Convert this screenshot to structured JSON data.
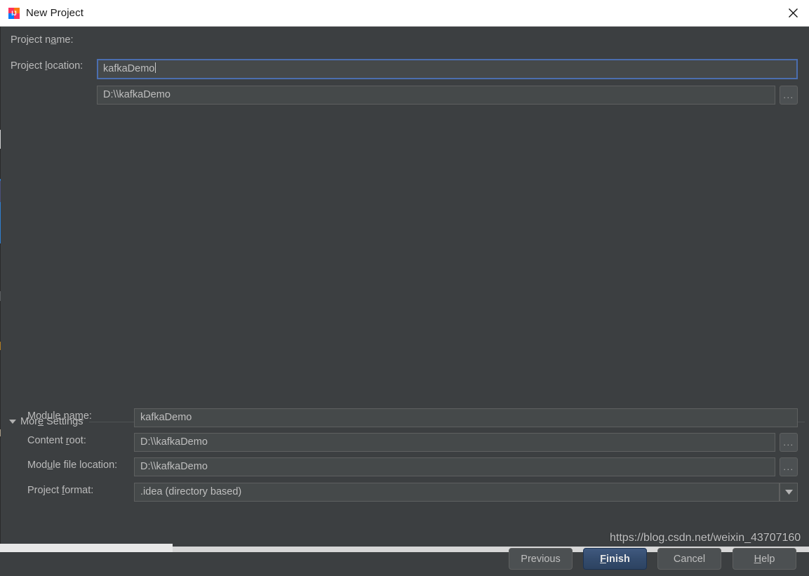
{
  "window": {
    "title": "New Project",
    "app_icon": "intellij-idea-icon",
    "close_icon": "close-icon"
  },
  "form": {
    "project_name": {
      "label": "Project name:",
      "label_mnemonic": "a",
      "value": "kafkaDemo",
      "focused": true
    },
    "project_location": {
      "label": "Project location:",
      "label_mnemonic": "l",
      "value": "D:\\\\kafkaDemo",
      "browse_label": "...",
      "browse_icon": "ellipsis-icon"
    }
  },
  "more_settings": {
    "label": "More Settings",
    "label_mnemonic": "e",
    "expanded": true,
    "toggle_icon": "triangle-down-icon",
    "fields": [
      {
        "name": "module-name",
        "label": "Module name:",
        "label_mnemonic": "m",
        "value": "kafkaDemo",
        "has_browse": false,
        "has_dropdown": false
      },
      {
        "name": "content-root",
        "label": "Content root:",
        "label_mnemonic": "r",
        "value": "D:\\\\kafkaDemo",
        "has_browse": true,
        "browse_label": "...",
        "has_dropdown": false
      },
      {
        "name": "module-file-location",
        "label": "Module file location:",
        "label_mnemonic": "u",
        "value": "D:\\\\kafkaDemo",
        "has_browse": true,
        "browse_label": "...",
        "has_dropdown": false
      },
      {
        "name": "project-format",
        "label": "Project format:",
        "label_mnemonic": "f",
        "value": ".idea (directory based)",
        "has_browse": false,
        "has_dropdown": true,
        "dropdown_icon": "chevron-down-icon"
      }
    ]
  },
  "footer": {
    "previous": "Previous",
    "finish": "Finish",
    "finish_mnemonic": "F",
    "cancel": "Cancel",
    "help": "Help",
    "help_mnemonic": "H",
    "default_button": "Finish"
  },
  "watermark": {
    "text": "https://blog.csdn.net/weixin_43707160"
  },
  "colors": {
    "dialog_bg": "#3c3f41",
    "field_bg": "#45494a",
    "field_border": "#5e6060",
    "focus_border": "#4b6eaf",
    "text": "#bbbbbb",
    "titlebar_bg": "#ffffff",
    "primary_button": "#344c6e"
  }
}
